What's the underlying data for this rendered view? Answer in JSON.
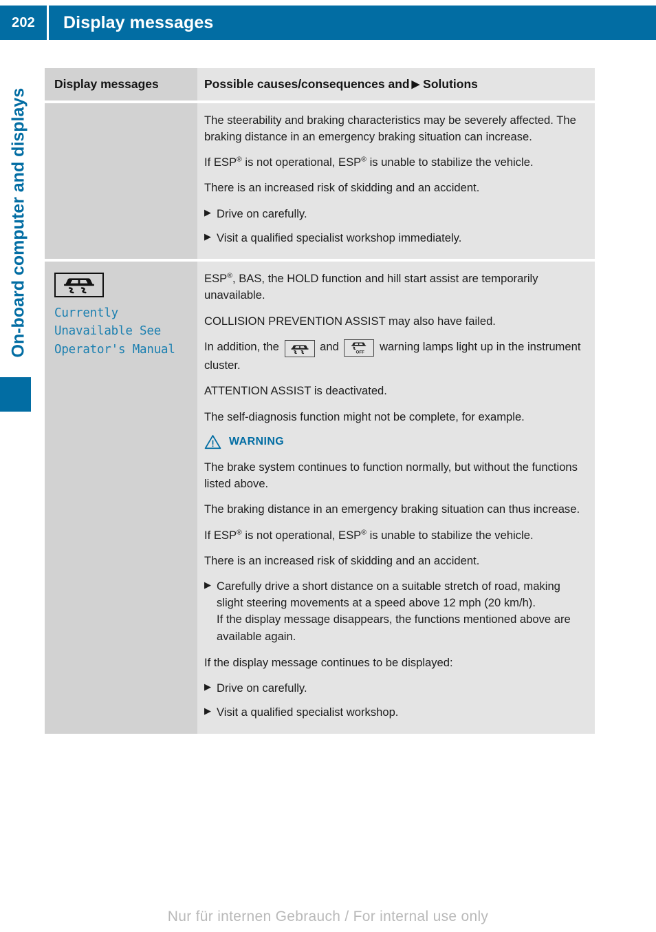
{
  "header": {
    "page_number": "202",
    "title": "Display messages"
  },
  "sidebar": {
    "chapter_label": "On-board computer and displays"
  },
  "table": {
    "columns": {
      "left_header": "Display messages",
      "right_header_pre": "Possible causes/consequences and",
      "right_header_post": "Solutions"
    },
    "rows": [
      {
        "left": {
          "icon": null,
          "message": null
        },
        "right": {
          "paragraphs": [
            "The steerability and braking characteristics may be severely affected. The braking distance in an emergency braking situation can increase.",
            "There is an increased risk of skidding and an accident."
          ],
          "esp_line_pre": "If ESP",
          "esp_line_mid": " is not operational, ESP",
          "esp_line_post": " is unable to stabilize the vehicle.",
          "bullets": [
            "Drive on carefully.",
            "Visit a qualified specialist workshop immediately."
          ]
        }
      }
    ]
  },
  "row2": {
    "left": {
      "icon_name": "esp-skid-icon",
      "message_line1": "Currently",
      "message_line2": "Unavailable See",
      "message_line3": "Operator's Manual"
    },
    "right": {
      "p1_pre": "ESP",
      "p1_post": ", BAS, the HOLD function and hill start assist are temporarily unavailable.",
      "p2": "COLLISION PREVENTION ASSIST may also have failed.",
      "p3_pre": "In addition, the",
      "p3_mid": "and",
      "p3_post": "warning lamps light up in the instrument cluster.",
      "p4": "ATTENTION ASSIST is deactivated.",
      "p5": "The self-diagnosis function might not be complete, for example.",
      "warning": {
        "label": "WARNING",
        "icon_name": "warning-triangle-icon",
        "paragraphs": [
          "The brake system continues to function normally, but without the functions listed above.",
          "The braking distance in an emergency braking situation can thus increase.",
          "There is an increased risk of skidding and an accident."
        ],
        "esp_line_pre": "If ESP",
        "esp_line_mid": " is not operational, ESP",
        "esp_line_post": " is unable to stabilize the vehicle.",
        "bullet_long": "Carefully drive a short distance on a suitable stretch of road, making slight steering movements at a speed above 12 mph (20 km/h).",
        "bullet_long_second": "If the display message disappears, the functions mentioned above are available again.",
        "closing_line": "If the display message continues to be displayed:",
        "bullets": [
          "Drive on carefully.",
          "Visit a qualified specialist workshop."
        ]
      }
    }
  },
  "icons": {
    "triangle_bullet": "▶",
    "registered": "®"
  },
  "footer": {
    "text": "Nur für internen Gebrauch / For internal use only"
  },
  "colors": {
    "brand_blue": "#026da3",
    "cluster_text_blue": "#1a7fb0",
    "col_left_bg": "#d2d2d2",
    "col_right_bg": "#e4e4e4"
  }
}
